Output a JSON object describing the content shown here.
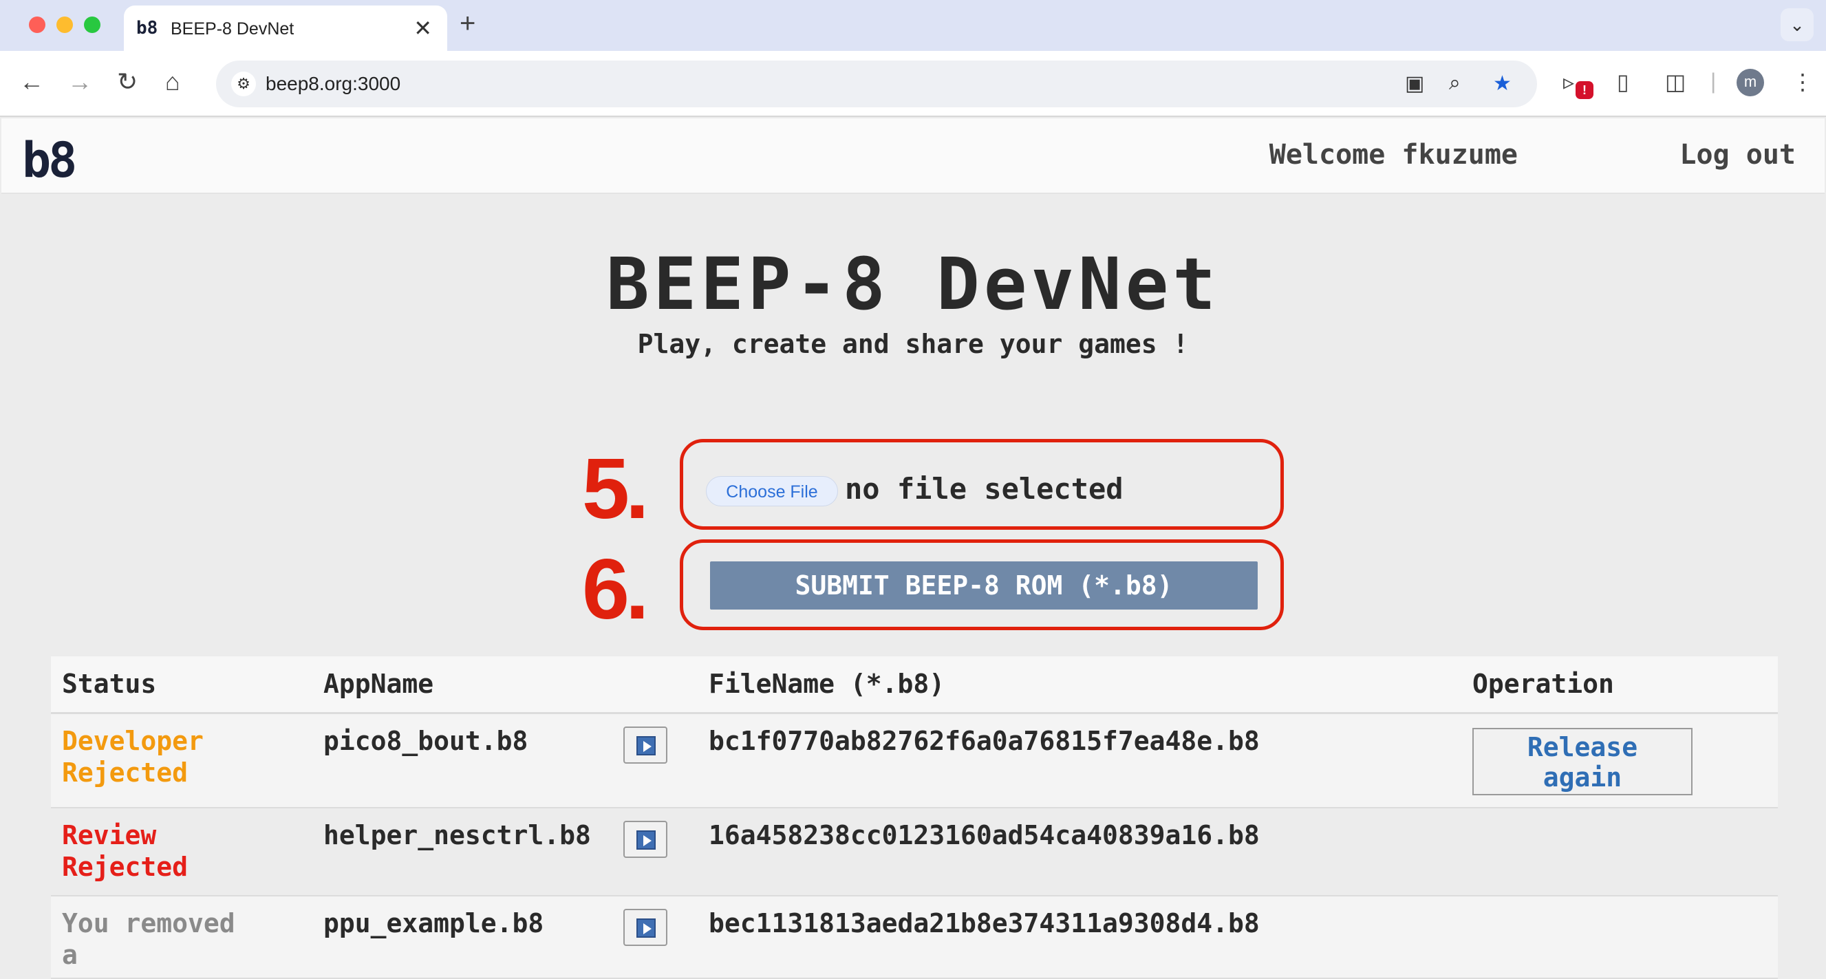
{
  "browser": {
    "tab_title": "BEEP-8 DevNet",
    "tab_logo": "b8",
    "close_glyph": "✕",
    "new_tab_glyph": "+",
    "menu_glyph": "⌄",
    "url": "beep8.org:3000",
    "avatar_letter": "m",
    "badge": "!",
    "icons": [
      "back-icon",
      "forward-icon",
      "reload-icon",
      "home-icon",
      "site-info-icon",
      "translate-icon",
      "zoom-icon",
      "bookmark-star-icon",
      "extension-icon",
      "mouse-icon",
      "puzzle-icon",
      "menu-icon"
    ]
  },
  "header": {
    "logo": "b8",
    "welcome": "Welcome fkuzume",
    "logout": "Log out"
  },
  "hero": {
    "title": "BEEP-8 DevNet",
    "subtitle": "Play, create and share your games !"
  },
  "upload": {
    "step5": "5.",
    "step6": "6.",
    "choose_file": "Choose File",
    "no_file": "no file selected",
    "submit": "SUBMIT BEEP-8 ROM (*.b8)"
  },
  "table": {
    "headers": [
      "Status",
      "AppName",
      "",
      "FileName (*.b8)",
      "Operation"
    ],
    "rows": [
      {
        "status_line1": "Developer",
        "status_line2": "Rejected",
        "app": "pico8_bout.b8",
        "file": "bc1f0770ab82762f6a0a76815f7ea48e.b8",
        "op_line1": "Release",
        "op_line2": "again"
      },
      {
        "status_line1": "Review",
        "status_line2": "Rejected",
        "app": "helper_nesctrl.b8",
        "file": "16a458238cc0123160ad54ca40839a16.b8",
        "op_line1": "",
        "op_line2": ""
      },
      {
        "status_line1": "You removed",
        "status_line2": "a",
        "app": "ppu_example.b8",
        "file": "bec1131813aeda21b8e374311a9308d4.b8",
        "op_line1": "",
        "op_line2": ""
      }
    ]
  },
  "colors": {
    "accent_red": "#e0210d",
    "status_orange": "#f39a0f",
    "status_red": "#e51f19",
    "submit_bg": "#7089a8",
    "link_blue": "#2f6eb5"
  }
}
